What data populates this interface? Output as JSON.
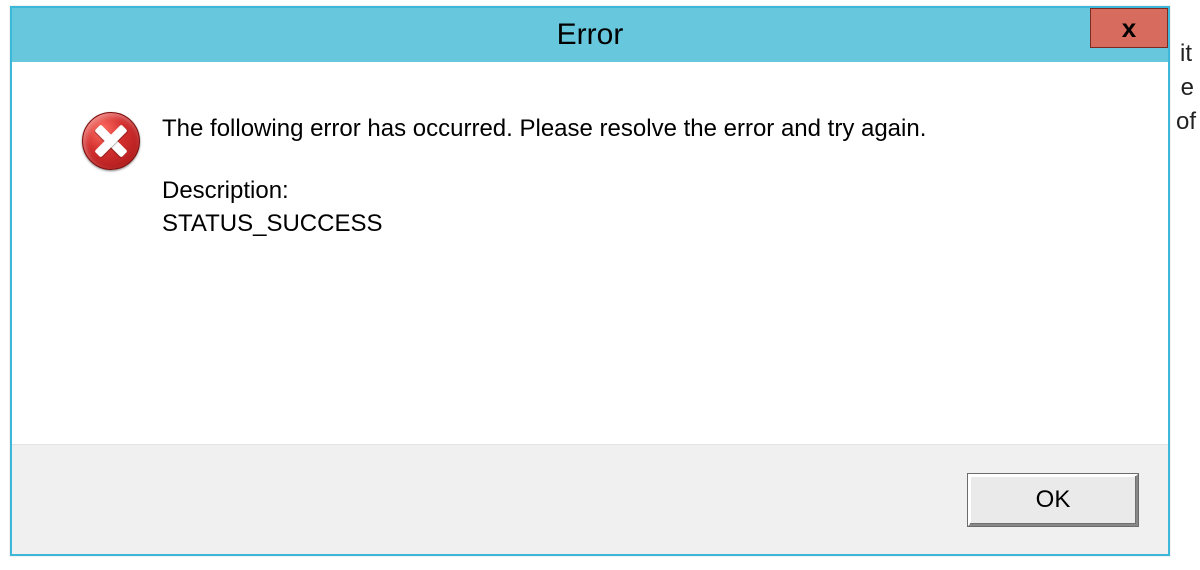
{
  "dialog": {
    "title": "Error",
    "close_label": "x",
    "message": "The following error has occurred. Please resolve the error and try again.",
    "description_label": "Description:",
    "description_value": "STATUS_SUCCESS",
    "ok_label": "OK"
  },
  "background_fragments": {
    "f1": "it",
    "f2": "e",
    "f3": "of"
  }
}
